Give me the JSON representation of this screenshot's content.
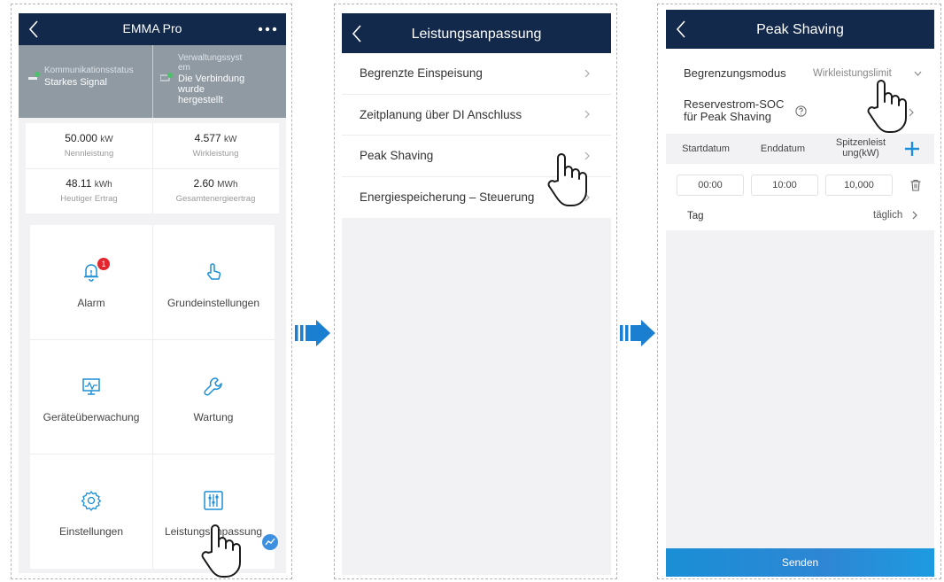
{
  "screen1": {
    "title": "EMMA Pro",
    "status": {
      "comm_label": "Kommunikationsstatus",
      "comm_value": "Starkes Signal",
      "mgmt_label_l1": "Verwaltungssyst",
      "mgmt_label_l2": "em",
      "mgmt_value_l1": "Die Verbindung",
      "mgmt_value_l2": "wurde",
      "mgmt_value_l3": "hergestellt"
    },
    "stats": [
      {
        "value": "50.000",
        "unit": "kW",
        "label": "Nennleistung"
      },
      {
        "value": "4.577",
        "unit": "kW",
        "label": "Wirkleistung"
      },
      {
        "value": "48.11",
        "unit": "kWh",
        "label": "Heutiger Ertrag"
      },
      {
        "value": "2.60",
        "unit": "MWh",
        "label": "Gesamtenergieertrag"
      }
    ],
    "alarm_badge": "1",
    "tiles": [
      {
        "label": "Alarm",
        "icon": "bell-icon"
      },
      {
        "label": "Grundeinstellungen",
        "icon": "touch-icon"
      },
      {
        "label": "Geräteüberwachung",
        "icon": "monitor-icon"
      },
      {
        "label": "Wartung",
        "icon": "wrench-icon"
      },
      {
        "label": "Einstellungen",
        "icon": "gear-icon"
      },
      {
        "label": "Leistungsanpassung",
        "icon": "sliders-icon"
      }
    ]
  },
  "screen2": {
    "title": "Leistungsanpassung",
    "items": [
      "Begrenzte Einspeisung",
      "Zeitplanung über DI Anschluss",
      "Peak Shaving",
      "Energiespeicherung – Steuerung"
    ]
  },
  "screen3": {
    "title": "Peak Shaving",
    "mode_label": "Begrenzungsmodus",
    "mode_value": "Wirkleistungslimit",
    "soc_label_l1": "Reservestrom-SOC",
    "soc_label_l2": "für Peak Shaving",
    "columns": {
      "start": "Startdatum",
      "end": "Enddatum",
      "peak_l1": "Spitzenleist",
      "peak_l2": "ung(kW)"
    },
    "row": {
      "start": "00:00",
      "end": "10:00",
      "peak": "10,000"
    },
    "day_label": "Tag",
    "day_value": "täglich",
    "send_label": "Senden"
  },
  "colors": {
    "navbar": "#13294b",
    "accent": "#1a8fd6",
    "status_bg": "#8f9aa3",
    "badge": "#e3262d"
  }
}
